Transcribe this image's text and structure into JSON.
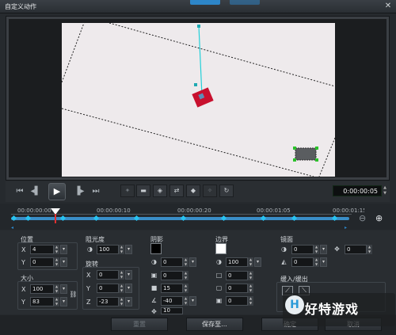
{
  "window": {
    "title": "自定义动作",
    "close_glyph": "✕"
  },
  "playback": {
    "timecode": "0:00:00:05",
    "buttons": [
      "home-icon",
      "prev-frame-icon",
      "play-icon",
      "next-frame-icon",
      "end-icon"
    ]
  },
  "editing_buttons": [
    "add-keyframe-icon",
    "remove-keyframe-icon",
    "reverse-icon",
    "swap-icon",
    "move-left-icon",
    "move-right-icon",
    "rotate-icon"
  ],
  "timeline": {
    "ticks": [
      "00:00:00:00",
      "00:00:00:10",
      "00:00:00:20",
      "00:00:01:05",
      "00:00:01:15"
    ],
    "zoom_out": "⊖",
    "zoom_in": "⊕"
  },
  "position": {
    "label": "位置",
    "x_label": "X",
    "x_value": "4",
    "y_label": "Y",
    "y_value": "0"
  },
  "size": {
    "label": "大小",
    "x_label": "X",
    "x_value": "100",
    "y_label": "Y",
    "y_value": "83"
  },
  "opacity": {
    "label": "阻光度",
    "value": "100"
  },
  "rotation": {
    "label": "旋转",
    "x_label": "X",
    "x_value": "0",
    "y_label": "Y",
    "y_value": "0",
    "z_label": "Z",
    "z_value": "-23"
  },
  "shadow": {
    "label": "阴影",
    "color": "#000000",
    "v1": "0",
    "v2": "0",
    "v3": "15",
    "v4": "-40",
    "v5": "10"
  },
  "border": {
    "label": "边界",
    "color": "#ffffff",
    "v1": "100",
    "v2": "0",
    "v3": "0",
    "v4": "0"
  },
  "mirror": {
    "label": "镜面",
    "v1": "0",
    "v2": "0",
    "v3": "0",
    "v4": "0"
  },
  "fade": {
    "label": "缓入/缓出"
  },
  "footer": {
    "reset": "重置",
    "save_as": "保存至...",
    "ok": "确定",
    "cancel": "取消"
  },
  "watermark": {
    "text": "好特游戏",
    "logo": "H"
  },
  "colors": {
    "accent": "#2d86c9",
    "keyframe": "#27c3f0",
    "object": "#c8102e",
    "path": "#22d0d8"
  }
}
